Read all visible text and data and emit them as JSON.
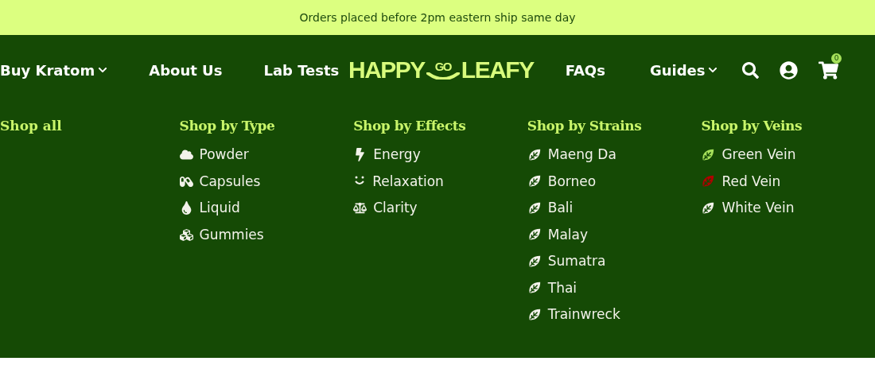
{
  "banner": {
    "text": "Orders placed before 2pm eastern ship same day"
  },
  "nav_left": [
    {
      "label": "Buy Kratom",
      "dropdown": true
    },
    {
      "label": "About Us",
      "dropdown": false
    },
    {
      "label": "Lab Tests",
      "dropdown": false
    }
  ],
  "logo": {
    "left": "HAPPY",
    "middle": "GO",
    "right": "LEAFY"
  },
  "nav_right": [
    {
      "label": "FAQs",
      "dropdown": false
    },
    {
      "label": "Guides",
      "dropdown": true
    }
  ],
  "cart": {
    "count": "0"
  },
  "menu": {
    "shop_all": "Shop all",
    "columns": [
      {
        "heading": "Shop by Type",
        "items": [
          {
            "label": "Powder",
            "kind": "powder"
          },
          {
            "label": "Capsules",
            "kind": "capsule"
          },
          {
            "label": "Liquid",
            "kind": "liquid"
          },
          {
            "label": "Gummies",
            "kind": "gummies"
          }
        ]
      },
      {
        "heading": "Shop by Effects",
        "items": [
          {
            "label": "Energy",
            "kind": "energy"
          },
          {
            "label": "Relaxation",
            "kind": "relaxation"
          },
          {
            "label": "Clarity",
            "kind": "clarity"
          }
        ]
      },
      {
        "heading": "Shop by Strains",
        "items": [
          {
            "label": "Maeng Da",
            "kind": "leaf",
            "color": "#f2f2ea"
          },
          {
            "label": "Borneo",
            "kind": "leaf",
            "color": "#f2f2ea"
          },
          {
            "label": "Bali",
            "kind": "leaf",
            "color": "#f2f2ea"
          },
          {
            "label": "Malay",
            "kind": "leaf",
            "color": "#f2f2ea"
          },
          {
            "label": "Sumatra",
            "kind": "leaf",
            "color": "#f2f2ea"
          },
          {
            "label": "Thai",
            "kind": "leaf",
            "color": "#f2f2ea"
          },
          {
            "label": "Trainwreck",
            "kind": "leaf",
            "color": "#f2f2ea"
          }
        ]
      },
      {
        "heading": "Shop by Veins",
        "items": [
          {
            "label": "Green Vein",
            "kind": "leaf",
            "color": "#a6e05a"
          },
          {
            "label": "Red Vein",
            "kind": "leaf",
            "color": "#b00000"
          },
          {
            "label": "White Vein",
            "kind": "leaf",
            "color": "#f2f2ea"
          }
        ]
      }
    ]
  }
}
